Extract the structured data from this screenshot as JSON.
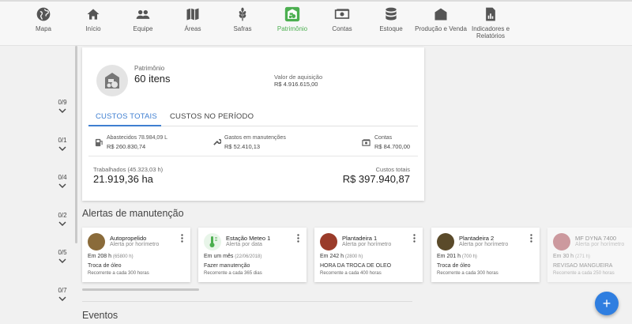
{
  "nav": {
    "items": [
      {
        "label": "Mapa",
        "icon": "globe-icon"
      },
      {
        "label": "Início",
        "icon": "home-icon"
      },
      {
        "label": "Equipe",
        "icon": "people-icon"
      },
      {
        "label": "Áreas",
        "icon": "map-icon"
      },
      {
        "label": "Safras",
        "icon": "wheat-icon"
      },
      {
        "label": "Patrimônio",
        "icon": "tractor-icon"
      },
      {
        "label": "Contas",
        "icon": "cash-icon"
      },
      {
        "label": "Estoque",
        "icon": "database-icon"
      },
      {
        "label": "Produção e Venda",
        "icon": "barn-icon"
      },
      {
        "label": "Indicadores e Relatórios",
        "icon": "report-icon"
      }
    ],
    "active": "Patrimônio",
    "accent": "#4caf50"
  },
  "rail": {
    "items": [
      "0/9",
      "0/1",
      "0/4",
      "0/2",
      "0/5",
      "0/7"
    ]
  },
  "summary": {
    "patrimonio_label": "Patrimônio",
    "patrimonio_count": "60 itens",
    "valor_label": "Valor de aquisição",
    "valor_value": "R$ 4.916.615,00",
    "tabs": [
      "CUSTOS TOTAIS",
      "CUSTOS NO PERÍODO"
    ],
    "active_tab": "CUSTOS TOTAIS",
    "tab_accent": "#3f7fd1",
    "metrics": [
      {
        "label": "Abastecidos 78.984,09 L",
        "value": "R$ 260.830,74",
        "icon": "fuel-icon"
      },
      {
        "label": "Gastos em manutenções",
        "value": "R$ 52.410,13",
        "icon": "wrench-icon"
      },
      {
        "label": "Contas",
        "value": "R$ 84.700,00",
        "icon": "cash-icon"
      }
    ],
    "trabalhados_label": "Trabalhados (45.323,03 h)",
    "trabalhados_value": "21.919,36 ha",
    "custos_totais_label": "Custos totais",
    "custos_totais_value": "R$ 397.940,87"
  },
  "alerts": {
    "title": "Alertas de manutenção",
    "items": [
      {
        "name": "Autopropelido",
        "type": "Alerta por horímetro",
        "when": "Em 208 h",
        "detail": "(65800 h)",
        "task": "Troca de óleo",
        "recurrence": "Recorrente a cada 300 horas",
        "thumb_color": "#8a6b3a"
      },
      {
        "name": "Estação Meteo 1",
        "type": "Alerta por data",
        "when": "Em um mês",
        "detail": "(22/06/2018)",
        "task": "Fazer manutenção",
        "recurrence": "Recorrente a cada 365 dias",
        "thumb_color": "#4caf50"
      },
      {
        "name": "Plantadeira 1",
        "type": "Alerta por horímetro",
        "when": "Em 242 h",
        "detail": "(2800 h)",
        "task": "HORA DA TROCA DE OLEO",
        "recurrence": "Recorrente a cada 400 horas",
        "thumb_color": "#9a3b2a"
      },
      {
        "name": "Plantadeira 2",
        "type": "Alerta por horímetro",
        "when": "Em 201 h",
        "detail": "(700 h)",
        "task": "Troca de óleo",
        "recurrence": "Recorrente a cada 300 horas",
        "thumb_color": "#5a4a2a"
      },
      {
        "name": "MF DYNA 7400",
        "type": "Alerta por horímetro",
        "when": "Em 30 h",
        "detail": "(271 h)",
        "task": "REVISAO MANGUEIRA",
        "recurrence": "Recorrente a cada 250 horas",
        "thumb_color": "#a0303a"
      }
    ]
  },
  "eventos": {
    "title": "Eventos"
  },
  "fab": {
    "label": "+"
  }
}
